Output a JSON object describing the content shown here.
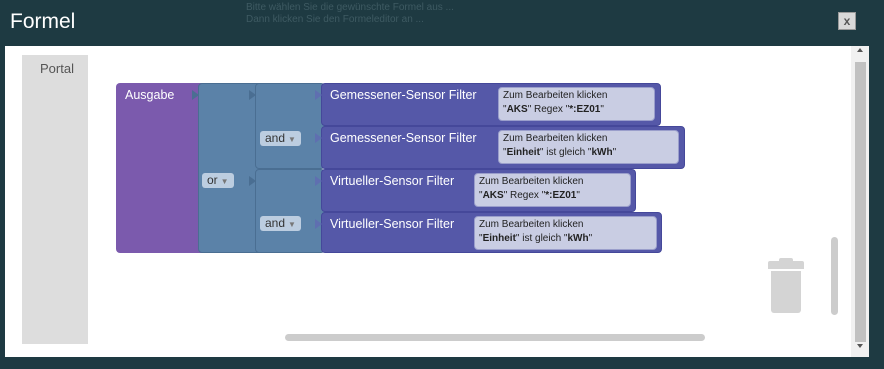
{
  "window": {
    "title": "Formel",
    "close_label": "x"
  },
  "background_text": [
    "Bitte wählen Sie die gewünschte Formel aus ...",
    "Dann klicken Sie den Formeleditor an ..."
  ],
  "sidebar": {
    "category": "Portal"
  },
  "blocks": {
    "output_label": "Ausgabe",
    "or_op": "or",
    "and_ops": [
      "and",
      "and"
    ],
    "filters": [
      {
        "type": "Gemessener-Sensor Filter",
        "hint": "Zum Bearbeiten klicken",
        "key": "AKS",
        "rule": "Regex",
        "value": "*:EZ01"
      },
      {
        "type": "Gemessener-Sensor Filter",
        "hint": "Zum Bearbeiten klicken",
        "key": "Einheit",
        "rule": "ist gleich",
        "value": "kWh"
      },
      {
        "type": "Virtueller-Sensor Filter",
        "hint": "Zum Bearbeiten klicken",
        "key": "AKS",
        "rule": "Regex",
        "value": "*:EZ01"
      },
      {
        "type": "Virtueller-Sensor Filter",
        "hint": "Zum Bearbeiten klicken",
        "key": "Einheit",
        "rule": "ist gleich",
        "value": "kWh"
      }
    ]
  },
  "colors": {
    "frame": "#1e3a42",
    "output_block": "#7b5aad",
    "operator_block": "#5b82a8",
    "filter_block": "#5558a8"
  }
}
